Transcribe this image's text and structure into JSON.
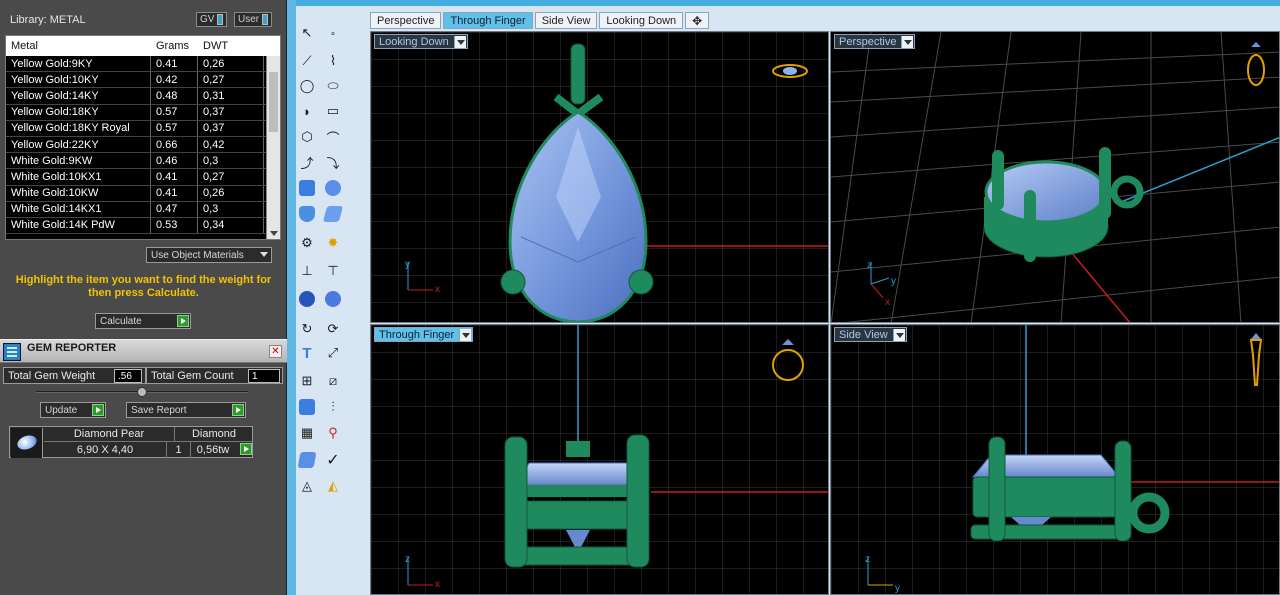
{
  "library": {
    "title": "Library: METAL",
    "gv_label": "GV",
    "user_label": "User"
  },
  "metal_table": {
    "columns": [
      "Metal",
      "Grams",
      "DWT"
    ],
    "rows": [
      [
        "Yellow Gold:9KY",
        "0.41",
        "0,26"
      ],
      [
        "Yellow Gold:10KY",
        "0.42",
        "0,27"
      ],
      [
        "Yellow Gold:14KY",
        "0.48",
        "0,31"
      ],
      [
        "Yellow Gold:18KY",
        "0.57",
        "0,37"
      ],
      [
        "Yellow Gold:18KY Royal",
        "0.57",
        "0,37"
      ],
      [
        "Yellow Gold:22KY",
        "0.66",
        "0,42"
      ],
      [
        "White Gold:9KW",
        "0.46",
        "0,3"
      ],
      [
        "White Gold:10KX1",
        "0.41",
        "0,27"
      ],
      [
        "White Gold:10KW",
        "0.41",
        "0,26"
      ],
      [
        "White Gold:14KX1",
        "0.47",
        "0,3"
      ],
      [
        "White Gold:14K PdW",
        "0.53",
        "0,34"
      ]
    ]
  },
  "use_object_materials": "Use Object Materials",
  "hint": "Highlight the item you want to find the weight for then press Calculate.",
  "calculate_label": "Calculate",
  "gem_reporter": {
    "title": "GEM REPORTER",
    "total_weight_label": "Total Gem Weight",
    "total_weight_value": ".56",
    "total_count_label": "Total Gem Count",
    "total_count_value": "1",
    "update_label": "Update",
    "save_label": "Save Report",
    "gem": {
      "name": "Diamond Pear",
      "material": "Diamond",
      "size": "6,90 X 4,40",
      "qty": "1",
      "carat": "0,56tw"
    }
  },
  "tabs": [
    "Perspective",
    "Through Finger",
    "Side View",
    "Looking Down"
  ],
  "active_tab": "Through Finger",
  "viewports": {
    "top_left": "Looking Down",
    "top_right": "Perspective",
    "bottom_left": "Through Finger",
    "bottom_right": "Side View"
  },
  "axis_labels": {
    "x": "x",
    "y": "y",
    "z": "z"
  },
  "colors": {
    "accent": "#5fc0ea",
    "metal": "#1e8a5e",
    "gem": "#7d9fe0",
    "hint": "#f2c400",
    "x_axis": "#c81e1e",
    "y_axis": "#2aa0d0"
  }
}
